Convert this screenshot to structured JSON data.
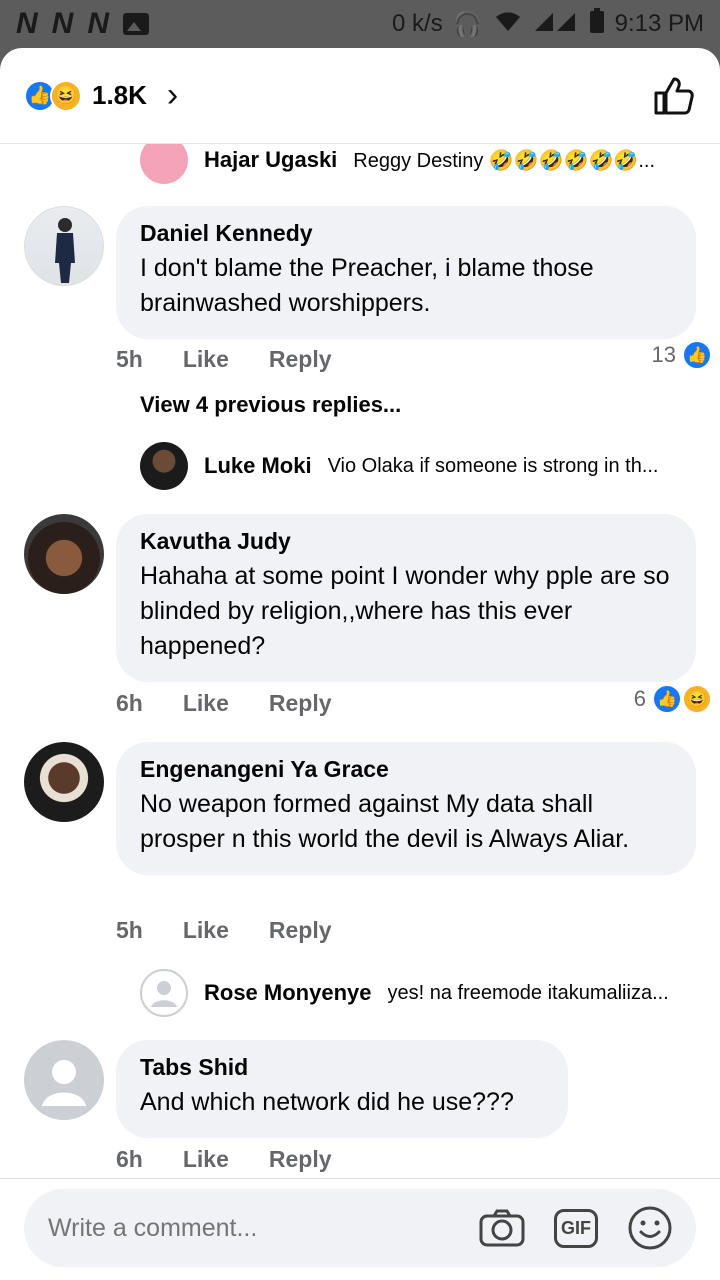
{
  "status_bar": {
    "net_speed": "0 k/s",
    "time": "9:13 PM",
    "carrier_icons": [
      "N",
      "N",
      "N"
    ]
  },
  "header": {
    "reaction_count": "1.8K",
    "reactions": [
      "like",
      "haha"
    ]
  },
  "comments": [
    {
      "kind": "reply-preview",
      "name": "Hajar Ugaski",
      "text": "Reggy Destiny 🤣🤣🤣🤣🤣🤣..."
    },
    {
      "kind": "comment",
      "name": "Daniel Kennedy",
      "text": "I don't blame the Preacher, i blame those brainwashed worshippers.",
      "time": "5h",
      "like_label": "Like",
      "reply_label": "Reply",
      "reaction_count": "13",
      "reactions": [
        "like"
      ]
    },
    {
      "kind": "view-previous",
      "text": "View 4 previous replies..."
    },
    {
      "kind": "reply-preview",
      "name": "Luke Moki",
      "text": "Vio Olaka if someone is strong in th..."
    },
    {
      "kind": "comment",
      "name": "Kavutha Judy",
      "text": "Hahaha at some point I wonder why pple are so blinded by religion,,where has this ever happened?",
      "time": "6h",
      "like_label": "Like",
      "reply_label": "Reply",
      "reaction_count": "6",
      "reactions": [
        "like",
        "haha"
      ]
    },
    {
      "kind": "comment",
      "name": "Engenangeni Ya Grace",
      "text": "No weapon formed against My data shall prosper n this world the devil is Always Aliar.",
      "time": "5h",
      "like_label": "Like",
      "reply_label": "Reply"
    },
    {
      "kind": "reply-preview",
      "name": "Rose Monyenye",
      "text": "yes! na freemode itakumaliiza..."
    },
    {
      "kind": "comment",
      "name": "Tabs Shid",
      "text": "And which network did he use???",
      "time": "6h",
      "like_label": "Like",
      "reply_label": "Reply"
    }
  ],
  "composer": {
    "placeholder": "Write a comment...",
    "gif_label": "GIF"
  },
  "colors": {
    "accent": "#1877f2",
    "bubble": "#f0f2f5",
    "secondary_text": "#65676b"
  }
}
